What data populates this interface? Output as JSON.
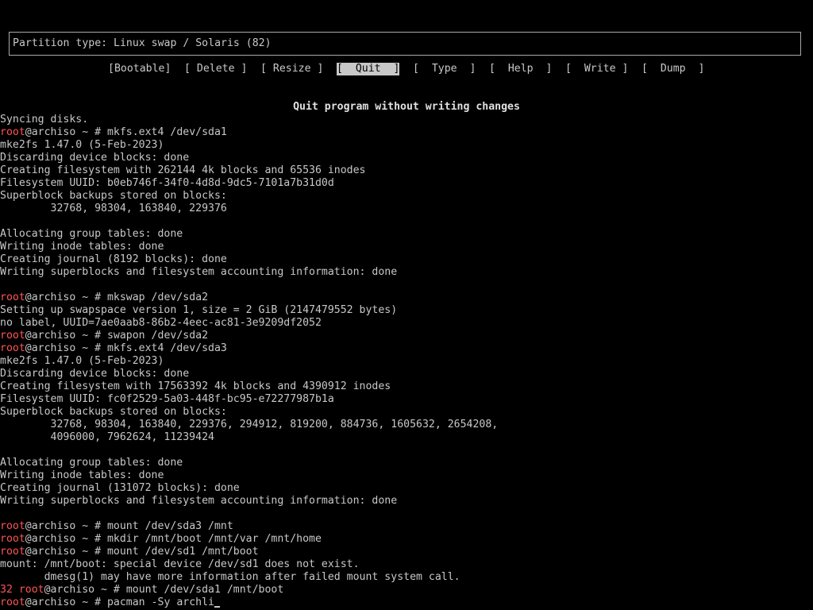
{
  "partition": {
    "type_text": "Partition type: Linux swap / Solaris (82)"
  },
  "menu": {
    "items": [
      {
        "label": "[Bootable]"
      },
      {
        "label": "[ Delete ]"
      },
      {
        "label": "[ Resize ]"
      },
      {
        "label": "[  Quit  ]",
        "selected": true
      },
      {
        "label": "[  Type  ]"
      },
      {
        "label": "[  Help  ]"
      },
      {
        "label": "[  Write ]"
      },
      {
        "label": "[  Dump  ]"
      }
    ]
  },
  "hint": "Quit program without writing changes",
  "prompt": {
    "user": "root",
    "host_path": "@archiso ~ # "
  },
  "console": {
    "lines": [
      {
        "text": "Syncing disks."
      },
      {
        "cmd": "mkfs.ext4 /dev/sda1"
      },
      {
        "text": "mke2fs 1.47.0 (5-Feb-2023)"
      },
      {
        "text": "Discarding device blocks: done"
      },
      {
        "text": "Creating filesystem with 262144 4k blocks and 65536 inodes"
      },
      {
        "text": "Filesystem UUID: b0eb746f-34f0-4d8d-9dc5-7101a7b31d0d"
      },
      {
        "text": "Superblock backups stored on blocks:"
      },
      {
        "text": "        32768, 98304, 163840, 229376"
      },
      {
        "text": ""
      },
      {
        "text": "Allocating group tables: done"
      },
      {
        "text": "Writing inode tables: done"
      },
      {
        "text": "Creating journal (8192 blocks): done"
      },
      {
        "text": "Writing superblocks and filesystem accounting information: done"
      },
      {
        "text": ""
      },
      {
        "cmd": "mkswap /dev/sda2"
      },
      {
        "text": "Setting up swapspace version 1, size = 2 GiB (2147479552 bytes)"
      },
      {
        "text": "no label, UUID=7ae0aab8-86b2-4eec-ac81-3e9209df2052"
      },
      {
        "cmd": "swapon /dev/sda2"
      },
      {
        "cmd": "mkfs.ext4 /dev/sda3"
      },
      {
        "text": "mke2fs 1.47.0 (5-Feb-2023)"
      },
      {
        "text": "Discarding device blocks: done"
      },
      {
        "text": "Creating filesystem with 17563392 4k blocks and 4390912 inodes"
      },
      {
        "text": "Filesystem UUID: fc0f2529-5a03-448f-bc95-e72277987b1a"
      },
      {
        "text": "Superblock backups stored on blocks:"
      },
      {
        "text": "        32768, 98304, 163840, 229376, 294912, 819200, 884736, 1605632, 2654208,"
      },
      {
        "text": "        4096000, 7962624, 11239424"
      },
      {
        "text": ""
      },
      {
        "text": "Allocating group tables: done"
      },
      {
        "text": "Writing inode tables: done"
      },
      {
        "text": "Creating journal (131072 blocks): done"
      },
      {
        "text": "Writing superblocks and filesystem accounting information: done"
      },
      {
        "text": ""
      },
      {
        "cmd": "mount /dev/sda3 /mnt"
      },
      {
        "cmd": "mkdir /mnt/boot /mnt/var /mnt/home"
      },
      {
        "cmd": "mount /dev/sd1 /mnt/boot"
      },
      {
        "text": "mount: /mnt/boot: special device /dev/sd1 does not exist."
      },
      {
        "text": "       dmesg(1) may have more information after failed mount system call."
      },
      {
        "cmd": "mount /dev/sda1 /mnt/boot",
        "status": "32 "
      },
      {
        "cmd": "pacman -Sy archli",
        "cursor": true
      }
    ]
  }
}
